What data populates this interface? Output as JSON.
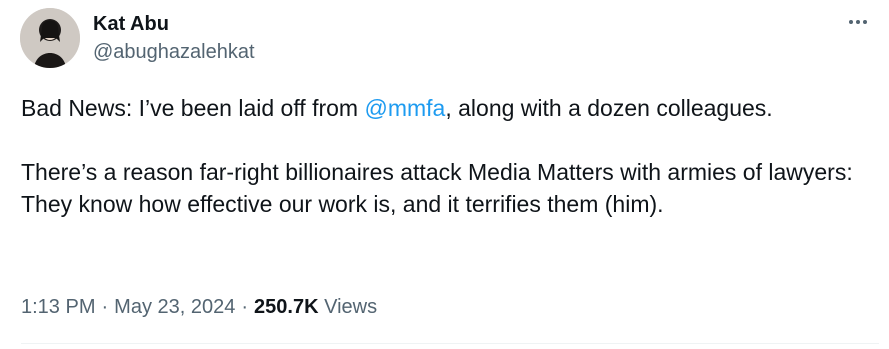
{
  "author": {
    "name": "Kat Abu",
    "handle": "@abughazalehkat"
  },
  "tweet": {
    "para1_before": "Bad News: I’ve been laid off from ",
    "mention": "@mmfa",
    "para1_after": ", along with a dozen colleagues.",
    "para2": "There’s a reason far-right billionaires attack Media Matters with armies of lawyers: They know how effective our work is, and it terrifies them (him)."
  },
  "meta": {
    "time": "1:13 PM",
    "date": "May 23, 2024",
    "separator": "·",
    "views_count": "250.7K",
    "views_label": "Views"
  },
  "colors": {
    "text": "#0f1419",
    "secondary": "#536471",
    "link": "#1d9bf0"
  },
  "icons": {
    "more": "more-icon"
  }
}
